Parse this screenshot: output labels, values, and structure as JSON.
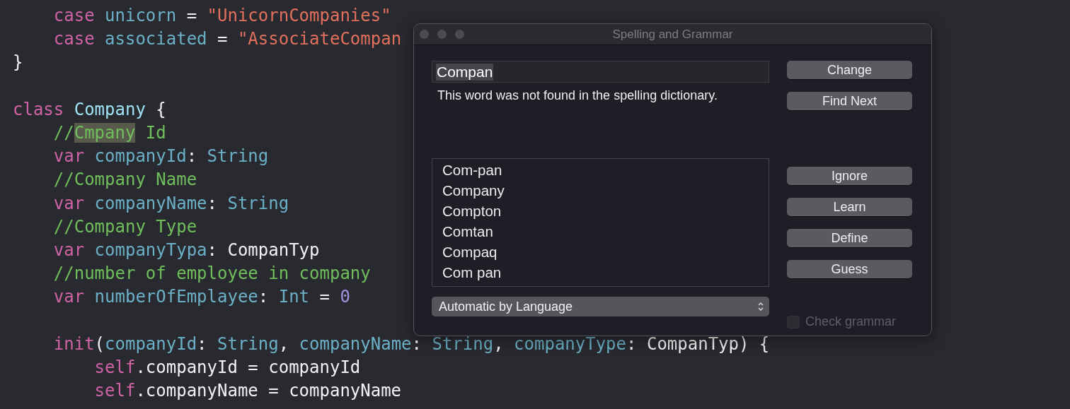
{
  "code_lines": [
    {
      "kind": "code",
      "tokens": [
        {
          "text": "    case ",
          "kind": "keyword"
        },
        {
          "text": "unicorn",
          "kind": "identifier"
        },
        {
          "text": " = ",
          "kind": "plain"
        },
        {
          "text": "\"UnicornCompanies\"",
          "kind": "string"
        }
      ]
    },
    {
      "kind": "code",
      "tokens": [
        {
          "text": "    case ",
          "kind": "keyword"
        },
        {
          "text": "associated",
          "kind": "identifier"
        },
        {
          "text": " = ",
          "kind": "plain"
        },
        {
          "text": "\"AssociateCompan",
          "kind": "string"
        }
      ]
    },
    {
      "kind": "code",
      "tokens": [
        {
          "text": "}",
          "kind": "plain"
        }
      ]
    },
    {
      "kind": "blank"
    },
    {
      "kind": "code",
      "tokens": [
        {
          "text": "class ",
          "kind": "keyword"
        },
        {
          "text": "Company",
          "kind": "type-name"
        },
        {
          "text": " {",
          "kind": "plain"
        }
      ]
    },
    {
      "kind": "code",
      "tokens": [
        {
          "text": "    //",
          "kind": "comment"
        },
        {
          "text": "Cmpany",
          "kind": "misspelled"
        },
        {
          "text": " Id",
          "kind": "comment"
        }
      ]
    },
    {
      "kind": "code",
      "tokens": [
        {
          "text": "    var ",
          "kind": "keyword"
        },
        {
          "text": "companyId",
          "kind": "identifier"
        },
        {
          "text": ": ",
          "kind": "plain"
        },
        {
          "text": "String",
          "kind": "identifier"
        }
      ]
    },
    {
      "kind": "code",
      "tokens": [
        {
          "text": "    //Company Name",
          "kind": "comment"
        }
      ]
    },
    {
      "kind": "code",
      "tokens": [
        {
          "text": "    var ",
          "kind": "keyword"
        },
        {
          "text": "companyName",
          "kind": "identifier"
        },
        {
          "text": ": ",
          "kind": "plain"
        },
        {
          "text": "String",
          "kind": "identifier"
        }
      ]
    },
    {
      "kind": "code",
      "tokens": [
        {
          "text": "    //Company Type",
          "kind": "comment"
        }
      ]
    },
    {
      "kind": "code",
      "tokens": [
        {
          "text": "    var ",
          "kind": "keyword"
        },
        {
          "text": "companyTypa",
          "kind": "identifier"
        },
        {
          "text": ": CompanTyp",
          "kind": "plain"
        }
      ]
    },
    {
      "kind": "code",
      "tokens": [
        {
          "text": "    //number of employee in company",
          "kind": "comment"
        }
      ]
    },
    {
      "kind": "code",
      "tokens": [
        {
          "text": "    var ",
          "kind": "keyword"
        },
        {
          "text": "numberOfEmplayee",
          "kind": "identifier"
        },
        {
          "text": ": ",
          "kind": "plain"
        },
        {
          "text": "Int",
          "kind": "identifier"
        },
        {
          "text": " = ",
          "kind": "plain"
        },
        {
          "text": "0",
          "kind": "number"
        }
      ]
    },
    {
      "kind": "blank"
    },
    {
      "kind": "code",
      "tokens": [
        {
          "text": "    init",
          "kind": "keyword"
        },
        {
          "text": "(",
          "kind": "plain"
        },
        {
          "text": "companyId",
          "kind": "identifier"
        },
        {
          "text": ": ",
          "kind": "plain"
        },
        {
          "text": "String",
          "kind": "identifier"
        },
        {
          "text": ", ",
          "kind": "plain"
        },
        {
          "text": "companyName",
          "kind": "identifier"
        },
        {
          "text": ": ",
          "kind": "plain"
        },
        {
          "text": "String",
          "kind": "identifier"
        },
        {
          "text": ", ",
          "kind": "plain"
        },
        {
          "text": "companyType",
          "kind": "identifier"
        },
        {
          "text": ": CompanTyp) {",
          "kind": "plain"
        }
      ]
    },
    {
      "kind": "code",
      "tokens": [
        {
          "text": "        self",
          "kind": "keyword"
        },
        {
          "text": ".companyId = companyId",
          "kind": "plain"
        }
      ]
    },
    {
      "kind": "code",
      "tokens": [
        {
          "text": "        self",
          "kind": "keyword"
        },
        {
          "text": ".companyName = companyName",
          "kind": "plain"
        }
      ]
    }
  ],
  "dialog": {
    "title": "Spelling and Grammar",
    "word_field": {
      "value": "Compan"
    },
    "message": "This word was not found in the spelling dictionary.",
    "top_buttons": [
      "Change",
      "Find Next"
    ],
    "suggestions": [
      {
        "label": "Com-pan",
        "selected": false
      },
      {
        "label": "Company",
        "selected": false
      },
      {
        "label": "Compton",
        "selected": false
      },
      {
        "label": "Comtan",
        "selected": false
      },
      {
        "label": "Compaq",
        "selected": false
      },
      {
        "label": "Com pan",
        "selected": false
      }
    ],
    "side_buttons": [
      "Ignore",
      "Learn",
      "Define",
      "Guess"
    ],
    "language_popup": {
      "value": "Automatic by Language"
    },
    "check_grammar": {
      "label": "Check grammar",
      "checked": false,
      "disabled": true
    }
  }
}
